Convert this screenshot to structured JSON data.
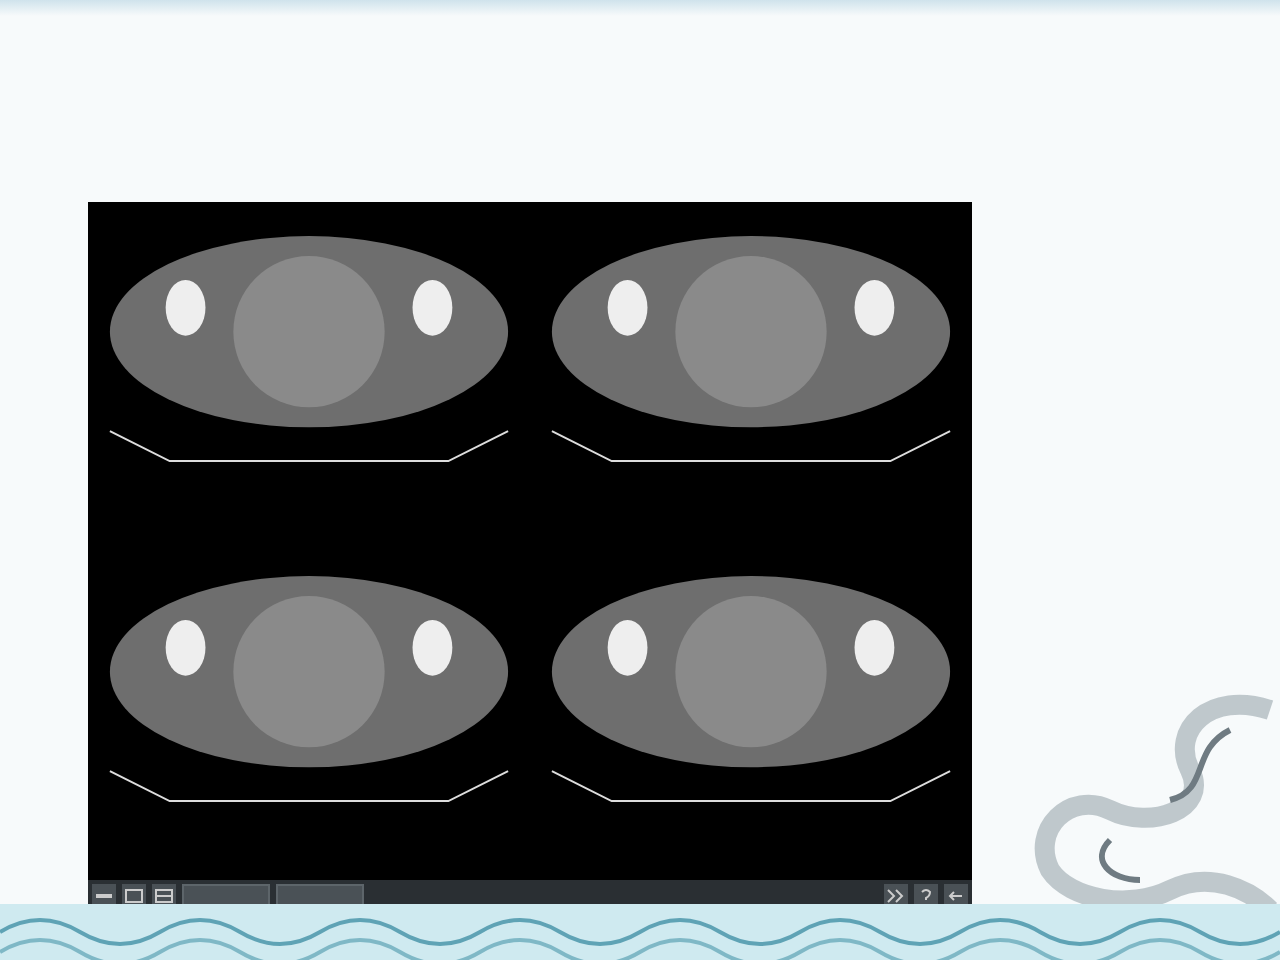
{
  "viewer": {
    "images": [
      {
        "kind": "ct-axial"
      },
      {
        "kind": "ct-axial"
      },
      {
        "kind": "ct-axial"
      },
      {
        "kind": "ct-axial"
      }
    ],
    "toolbar": {
      "left_buttons": [
        {
          "kind": "minus"
        },
        {
          "kind": "window"
        },
        {
          "kind": "grid"
        },
        {
          "kind": "wide"
        },
        {
          "kind": "wide"
        }
      ],
      "right_buttons": [
        {
          "kind": "forward"
        },
        {
          "kind": "help"
        },
        {
          "kind": "back"
        }
      ]
    }
  }
}
